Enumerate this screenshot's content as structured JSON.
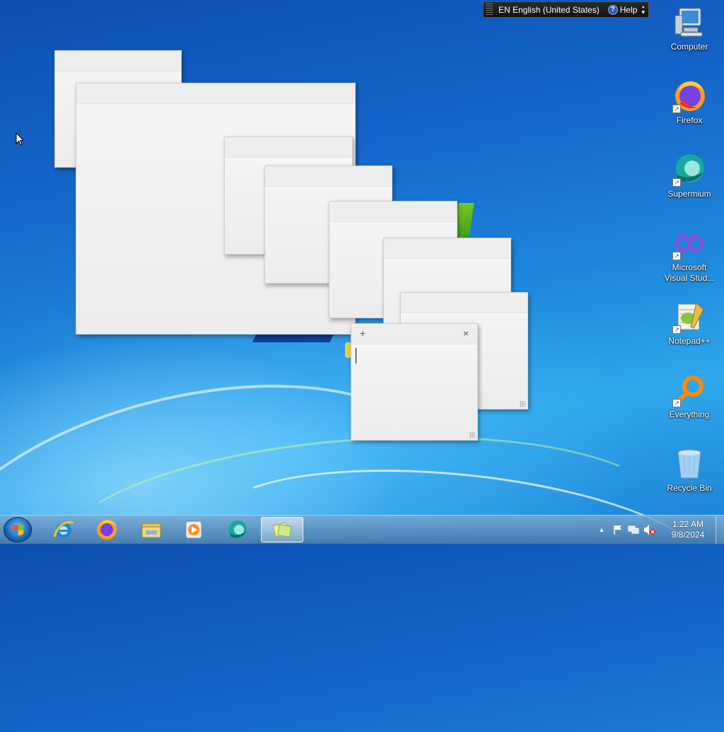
{
  "language_bar": {
    "language": "EN English (United States)",
    "help_label": "Help",
    "help_glyph": "?"
  },
  "desktop_icons": [
    {
      "label": "Computer",
      "icon": "computer-icon"
    },
    {
      "label": "Firefox",
      "icon": "firefox-icon"
    },
    {
      "label": "Supermium",
      "icon": "supermium-icon"
    },
    {
      "label": "Microsoft Visual Stud...",
      "icon": "visual-studio-icon"
    },
    {
      "label": "Notepad++",
      "icon": "notepadpp-icon"
    },
    {
      "label": "Everything",
      "icon": "everything-icon"
    },
    {
      "label": "Recycle Bin",
      "icon": "recycle-bin-icon"
    }
  ],
  "sticky_notes": {
    "new_glyph": "+",
    "close_glyph": "×"
  },
  "taskbar": {
    "pinned": [
      "internet-explorer-icon",
      "firefox-icon",
      "file-explorer-icon",
      "media-player-icon",
      "supermium-icon",
      "sticky-notes-icon"
    ],
    "active": "sticky-notes-icon"
  },
  "tray": {
    "expand_glyph": "▲",
    "time": "1:22 AM",
    "date": "9/8/2024"
  }
}
